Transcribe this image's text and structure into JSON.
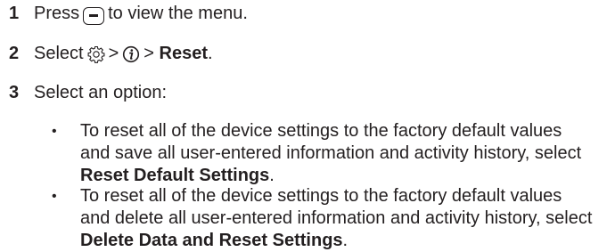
{
  "steps": [
    {
      "number": "1",
      "before_icon": "Press",
      "icon": "menu-key-icon",
      "after_icon": "to view the menu."
    },
    {
      "number": "2",
      "before": "Select",
      "icon1": "gear-icon",
      "sep1": ">",
      "icon2": "info-icon",
      "sep2": ">",
      "bold": "Reset",
      "tail": "."
    },
    {
      "number": "3",
      "text": "Select an option:"
    }
  ],
  "options": [
    {
      "bullet": "•",
      "text": "To reset all of the device settings to the factory default values and save all user-entered information and activity history, select ",
      "bold": "Reset Default Settings",
      "tail": "."
    },
    {
      "bullet": "•",
      "text": "To reset all of the device settings to the factory default values and delete all user-entered information and activity history, select ",
      "bold": "Delete Data and Reset Settings",
      "tail": "."
    }
  ]
}
